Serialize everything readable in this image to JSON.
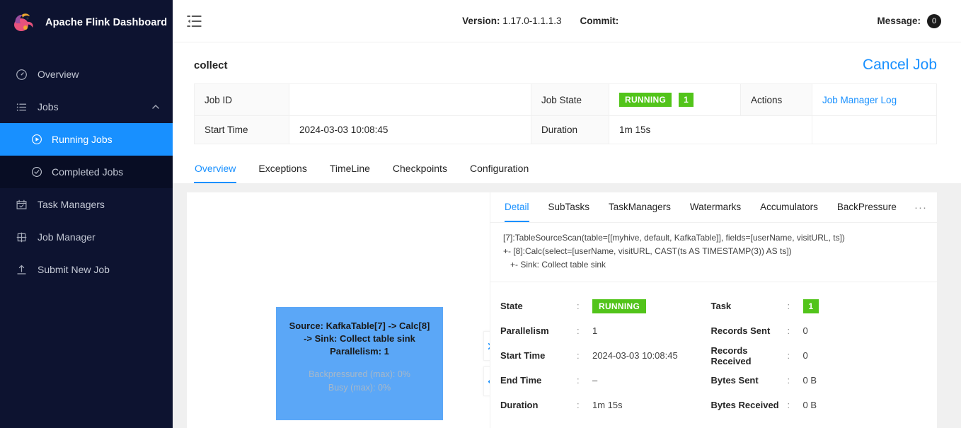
{
  "sidebar": {
    "brand": "Apache Flink Dashboard",
    "items": [
      {
        "label": "Overview",
        "icon": "dashboard-icon"
      },
      {
        "label": "Jobs",
        "icon": "list-icon",
        "expanded": true
      },
      {
        "label": "Task Managers",
        "icon": "task-managers-icon"
      },
      {
        "label": "Job Manager",
        "icon": "job-manager-icon"
      },
      {
        "label": "Submit New Job",
        "icon": "upload-icon"
      }
    ],
    "sub_items": [
      {
        "label": "Running Jobs",
        "icon": "play-circle-icon",
        "active": true
      },
      {
        "label": "Completed Jobs",
        "icon": "check-circle-icon",
        "active": false
      }
    ]
  },
  "topbar": {
    "fold_icon": "menu-fold-icon",
    "version_label": "Version:",
    "version_value": "1.17.0-1.1.1.3",
    "commit_label": "Commit:",
    "commit_value": "",
    "message_label": "Message:",
    "message_count": "0"
  },
  "page": {
    "job_name": "collect",
    "cancel_label": "Cancel Job"
  },
  "info_table": {
    "job_id_label": "Job ID",
    "job_id_value": "",
    "job_state_label": "Job State",
    "job_state_value": "RUNNING",
    "job_state_count": "1",
    "actions_label": "Actions",
    "actions_link": "Job Manager Log",
    "start_time_label": "Start Time",
    "start_time_value": "2024-03-03 10:08:45",
    "duration_label": "Duration",
    "duration_value": "1m 15s"
  },
  "tabs": [
    {
      "label": "Overview",
      "active": true
    },
    {
      "label": "Exceptions",
      "active": false
    },
    {
      "label": "TimeLine",
      "active": false
    },
    {
      "label": "Checkpoints",
      "active": false
    },
    {
      "label": "Configuration",
      "active": false
    }
  ],
  "graph": {
    "node_title_line1": "Source: KafkaTable[7] -> Calc[8]",
    "node_title_line2": "-> Sink: Collect table sink",
    "node_parallelism": "Parallelism: 1",
    "node_backpressure": "Backpressured (max): 0%",
    "node_busy": "Busy (max): 0%",
    "expand_icon": "chevron-right-icon",
    "collapse_icon": "chevron-left-icon",
    "node_color": "#5ba7f7"
  },
  "detail": {
    "tabs": [
      {
        "label": "Detail",
        "active": true
      },
      {
        "label": "SubTasks",
        "active": false
      },
      {
        "label": "TaskManagers",
        "active": false
      },
      {
        "label": "Watermarks",
        "active": false
      },
      {
        "label": "Accumulators",
        "active": false
      },
      {
        "label": "BackPressure",
        "active": false
      }
    ],
    "more_label": "···",
    "plan": "[7]:TableSourceScan(table=[[myhive, default, KafkaTable]], fields=[userName, visitURL, ts])\n+- [8]:Calc(select=[userName, visitURL, CAST(ts AS TIMESTAMP(3)) AS ts])\n   +- Sink: Collect table sink",
    "left_rows": [
      {
        "key": "State",
        "sep": ":",
        "value": "RUNNING",
        "type": "badge"
      },
      {
        "key": "Parallelism",
        "sep": ":",
        "value": "1",
        "type": "text"
      },
      {
        "key": "Start Time",
        "sep": ":",
        "value": "2024-03-03 10:08:45",
        "type": "text"
      },
      {
        "key": "End Time",
        "sep": ":",
        "value": "–",
        "type": "text"
      },
      {
        "key": "Duration",
        "sep": ":",
        "value": "1m 15s",
        "type": "text"
      }
    ],
    "right_rows": [
      {
        "key": "Task",
        "sep": ":",
        "value": "1",
        "type": "badge-num"
      },
      {
        "key": "Records Sent",
        "sep": ":",
        "value": "0",
        "type": "text"
      },
      {
        "key": "Records Received",
        "sep": ":",
        "value": "0",
        "type": "text"
      },
      {
        "key": "Bytes Sent",
        "sep": ":",
        "value": "0 B",
        "type": "text"
      },
      {
        "key": "Bytes Received",
        "sep": ":",
        "value": "0 B",
        "type": "text"
      }
    ]
  },
  "colors": {
    "accent": "#1890ff",
    "sidebar_bg": "#0d1330",
    "success": "#52c41a",
    "node": "#5ba7f7"
  }
}
